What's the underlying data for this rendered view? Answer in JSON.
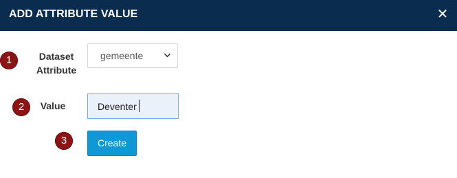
{
  "dialog": {
    "title": "ADD ATTRIBUTE VALUE",
    "close_symbol": "✕"
  },
  "steps": [
    {
      "number": "1",
      "label_line1": "Dataset",
      "label_line2": "Attribute"
    },
    {
      "number": "2",
      "label": "Value"
    },
    {
      "number": "3"
    }
  ],
  "form": {
    "dataset_attribute": {
      "selected": "gemeente",
      "icon": "chevron-down-icon"
    },
    "value": {
      "current": "Deventer"
    },
    "create_label": "Create"
  },
  "colors": {
    "header_bg": "#0a2d4f",
    "badge": "#8b1414",
    "primary_button": "#0f98d6",
    "input_focus_bg": "#eaf1fb"
  }
}
